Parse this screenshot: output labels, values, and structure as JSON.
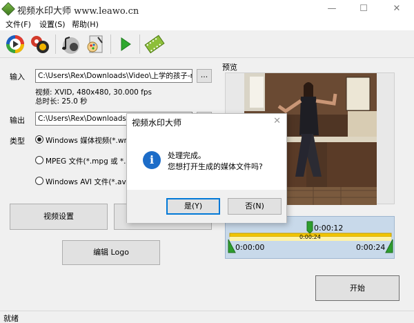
{
  "window": {
    "title": "视频水印大师 www.leawo.cn",
    "minimize": "—",
    "maximize": "☐",
    "close": "✕"
  },
  "menu": [
    {
      "label": "文件(F)"
    },
    {
      "label": "设置(S)"
    },
    {
      "label": "帮助(H)"
    }
  ],
  "toolbar": {
    "icons": [
      "play-circle-icon",
      "film-reel-icon",
      "music-notes-icon",
      "paint-palette-icon",
      "play-arrow-icon",
      "film-strip-icon"
    ]
  },
  "form": {
    "input_label": "输入",
    "input_path": "C:\\Users\\Rex\\Downloads\\Video\\上学的孩子-new.",
    "browse_label": "...",
    "video_info": "视频: XVID, 480x480, 30.000 fps",
    "duration": "总时长: 25.0 秒",
    "output_label": "输出",
    "output_path": "C:\\Users\\Rex\\Downloads\\Video\\上学的孩子-new.",
    "type_label": "类型",
    "type_options": [
      {
        "label": "Windows 媒体视频(*.wmv)",
        "selected": true
      },
      {
        "label": "MPEG 文件(*.mpg 或 *.mpeg)",
        "selected": false
      },
      {
        "label": "Windows AVI 文件(*.avi)",
        "selected": false
      }
    ]
  },
  "buttons": {
    "video_settings": "视频设置",
    "edit_logo": "编辑 Logo",
    "start": "开始"
  },
  "preview": {
    "label": "预览"
  },
  "timeline": {
    "current_time": "0:00:12",
    "range_label": "0:00:24",
    "start_time": "0:00:00",
    "end_time": "0:00:24",
    "position_fraction": 0.5
  },
  "status": {
    "text": "就绪"
  },
  "dialog": {
    "title": "视频水印大师",
    "close": "✕",
    "message_line1": "处理完成。",
    "message_line2": "您想打开生成的媒体文件吗?",
    "yes": "是(Y)",
    "no": "否(N)"
  },
  "colors": {
    "accent": "#0078d7",
    "info_icon": "#1c6cc8",
    "timeline_bg": "#c8d9ea",
    "timeline_bar": "#f2c500"
  }
}
